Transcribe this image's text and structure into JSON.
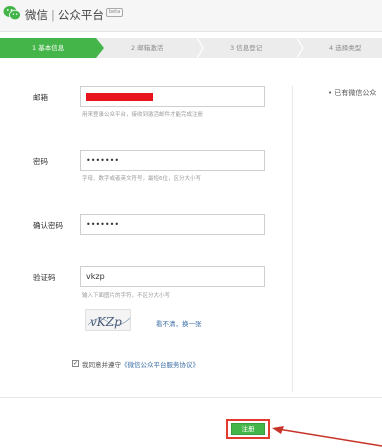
{
  "header": {
    "brand_main": "微信",
    "brand_sep": "|",
    "brand_sub": "公众平台",
    "beta": "beta"
  },
  "steps": [
    {
      "label": "1 基本信息",
      "active": true
    },
    {
      "label": "2 邮箱激活",
      "active": false
    },
    {
      "label": "3 信息登记",
      "active": false
    },
    {
      "label": "4 选择类型",
      "active": false
    }
  ],
  "form": {
    "email": {
      "label": "邮箱",
      "value": "",
      "hint": "用来登录公众平台，接收到激活邮件才能完成注册"
    },
    "password": {
      "label": "密码",
      "value": "•••••••",
      "hint": "字母、数字或者英文符号，最短6位，区分大小写"
    },
    "confirm": {
      "label": "确认密码",
      "value": "•••••••"
    },
    "captcha": {
      "label": "验证码",
      "value": "vkzp",
      "hint": "输入下面图片的字符，不区分大小写",
      "image_text": "vKZp",
      "refresh": "看不清，换一张"
    },
    "agree": {
      "prefix": "我同意并遵守",
      "link": "《微信公众平台服务协议》",
      "checked": "✓"
    }
  },
  "side": {
    "text": "已有微信公众"
  },
  "submit": {
    "label": "注册"
  },
  "colors": {
    "accent": "#44b549",
    "redaction": "#e8141c",
    "highlight": "#e53a2f",
    "link": "#3a6ea5"
  }
}
